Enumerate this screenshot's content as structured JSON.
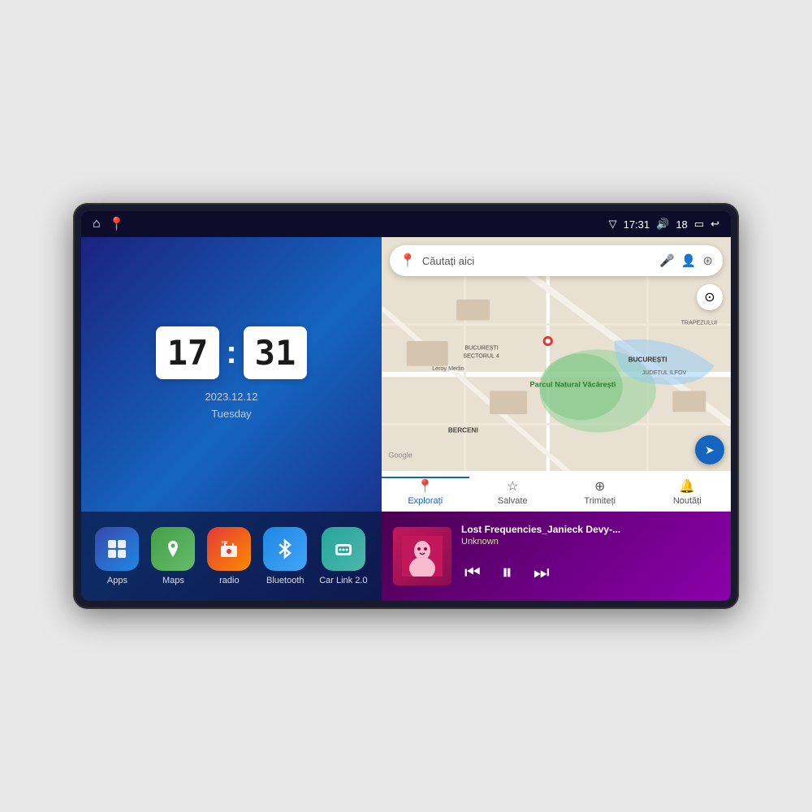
{
  "device": {
    "status_bar": {
      "time": "17:31",
      "battery": "18",
      "left_icons": [
        "home",
        "maps"
      ]
    }
  },
  "clock": {
    "hours": "17",
    "minutes": "31",
    "date": "2023.12.12",
    "day": "Tuesday"
  },
  "apps": [
    {
      "id": "apps",
      "label": "Apps",
      "icon": "⊞",
      "class": "icon-apps"
    },
    {
      "id": "maps",
      "label": "Maps",
      "icon": "📍",
      "class": "icon-maps"
    },
    {
      "id": "radio",
      "label": "radio",
      "icon": "📻",
      "class": "icon-radio"
    },
    {
      "id": "bluetooth",
      "label": "Bluetooth",
      "icon": "🔷",
      "class": "icon-bluetooth"
    },
    {
      "id": "carlink",
      "label": "Car Link 2.0",
      "icon": "🔗",
      "class": "icon-carlink"
    }
  ],
  "map": {
    "search_placeholder": "Căutați aici",
    "nav_items": [
      {
        "id": "explore",
        "label": "Explorați",
        "icon": "📍",
        "active": true
      },
      {
        "id": "saved",
        "label": "Salvate",
        "icon": "☆",
        "active": false
      },
      {
        "id": "share",
        "label": "Trimiteți",
        "icon": "⊕",
        "active": false
      },
      {
        "id": "news",
        "label": "Noutăți",
        "icon": "🔔",
        "active": false
      }
    ],
    "locations": [
      "BUCUREȘTI",
      "JUDEȚUL ILFOV",
      "TRAPEZULUI",
      "BERCENI",
      "Parcul Natural Văcărești",
      "Leroy Merlin",
      "BUCUREȘTI SECTORUL 4"
    ]
  },
  "music": {
    "title": "Lost Frequencies_Janieck Devy-...",
    "artist": "Unknown",
    "controls": {
      "prev": "⏮",
      "play": "⏸",
      "next": "⏭"
    }
  }
}
